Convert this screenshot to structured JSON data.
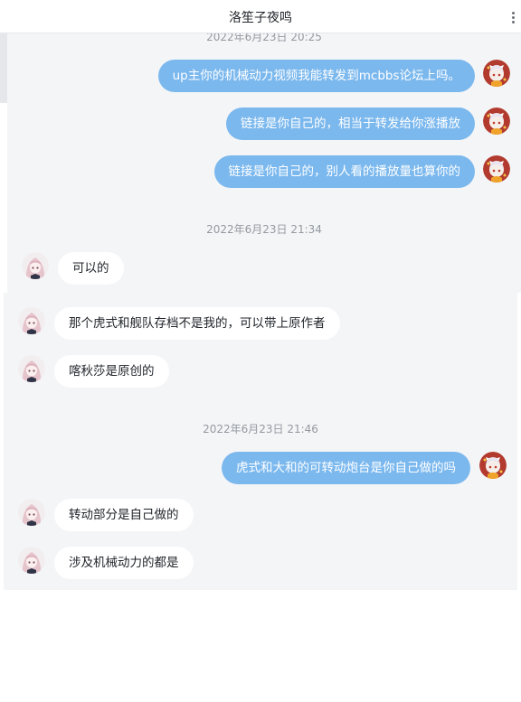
{
  "header": {
    "title": "洛笙子夜鸣"
  },
  "chat": {
    "ts0": "2022年6月23日 20:25",
    "m1": "up主你的机械动力视频我能转发到mcbbs论坛上吗。",
    "m2": "链接是你自己的，相当于转发给你涨播放",
    "m3": "链接是你自己的，别人看的播放量也算你的",
    "ts1": "2022年6月23日 21:34",
    "m4": "可以的",
    "m5": "那个虎式和舰队存档不是我的，可以带上原作者",
    "m6": "喀秋莎是原创的",
    "ts2": "2022年6月23日 21:46",
    "m7": "虎式和大和的可转动炮台是你自己做的吗",
    "m8": "转动部分是自己做的",
    "m9": "涉及机械动力的都是"
  },
  "colors": {
    "my_bubble": "#7bb8ee",
    "their_bubble": "#ffffff",
    "chat_background": "#f4f5f7"
  },
  "icons": {
    "more": "more-vertical-icon"
  }
}
